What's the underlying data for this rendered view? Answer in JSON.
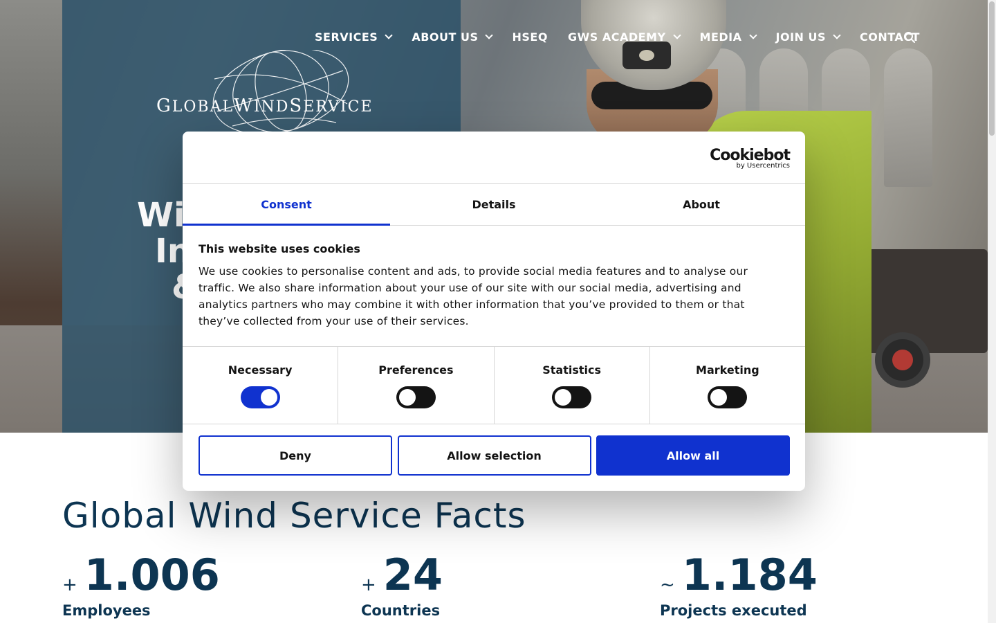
{
  "nav": {
    "items": [
      {
        "label": "SERVICES",
        "dropdown": true
      },
      {
        "label": "ABOUT US",
        "dropdown": true
      },
      {
        "label": "HSEQ",
        "dropdown": false
      },
      {
        "label": "GWS ACADEMY",
        "dropdown": true
      },
      {
        "label": "MEDIA",
        "dropdown": true
      },
      {
        "label": "JOIN US",
        "dropdown": true
      },
      {
        "label": "CONTACT",
        "dropdown": false
      }
    ],
    "search_icon": "search-icon"
  },
  "logo": {
    "text_prefix_g": "G",
    "text_lobal": "LOBAL",
    "text_w": "W",
    "text_ind": "IND",
    "text_s": "S",
    "text_ervice": "ERVICE"
  },
  "hero": {
    "title_lines": [
      "Wi",
      "In",
      "&"
    ]
  },
  "facts": {
    "title": "Global Wind Service Facts",
    "items": [
      {
        "prefix": "+",
        "value": "1.006",
        "label": "Employees"
      },
      {
        "prefix": "+",
        "value": "24",
        "label": "Countries"
      },
      {
        "prefix": "~",
        "value": "1.184",
        "label": "Projects executed"
      }
    ]
  },
  "cookie": {
    "brand": {
      "name": "Cookiebot",
      "sub": "by Usercentrics"
    },
    "tabs": [
      {
        "label": "Consent",
        "active": true
      },
      {
        "label": "Details",
        "active": false
      },
      {
        "label": "About",
        "active": false
      }
    ],
    "heading": "This website uses cookies",
    "text": "We use cookies to personalise content and ads, to provide social media features and to analyse our traffic. We also share information about your use of our site with our social media, advertising and analytics partners who may combine it with other information that you’ve provided to them or that they’ve collected from your use of their services.",
    "categories": [
      {
        "label": "Necessary",
        "on": true
      },
      {
        "label": "Preferences",
        "on": false
      },
      {
        "label": "Statistics",
        "on": false
      },
      {
        "label": "Marketing",
        "on": false
      }
    ],
    "buttons": {
      "deny": "Deny",
      "allow_selection": "Allow selection",
      "allow_all": "Allow all"
    }
  },
  "colors": {
    "accent": "#1032cf",
    "brand_dark": "#0d3552",
    "panel": "#264e66"
  }
}
